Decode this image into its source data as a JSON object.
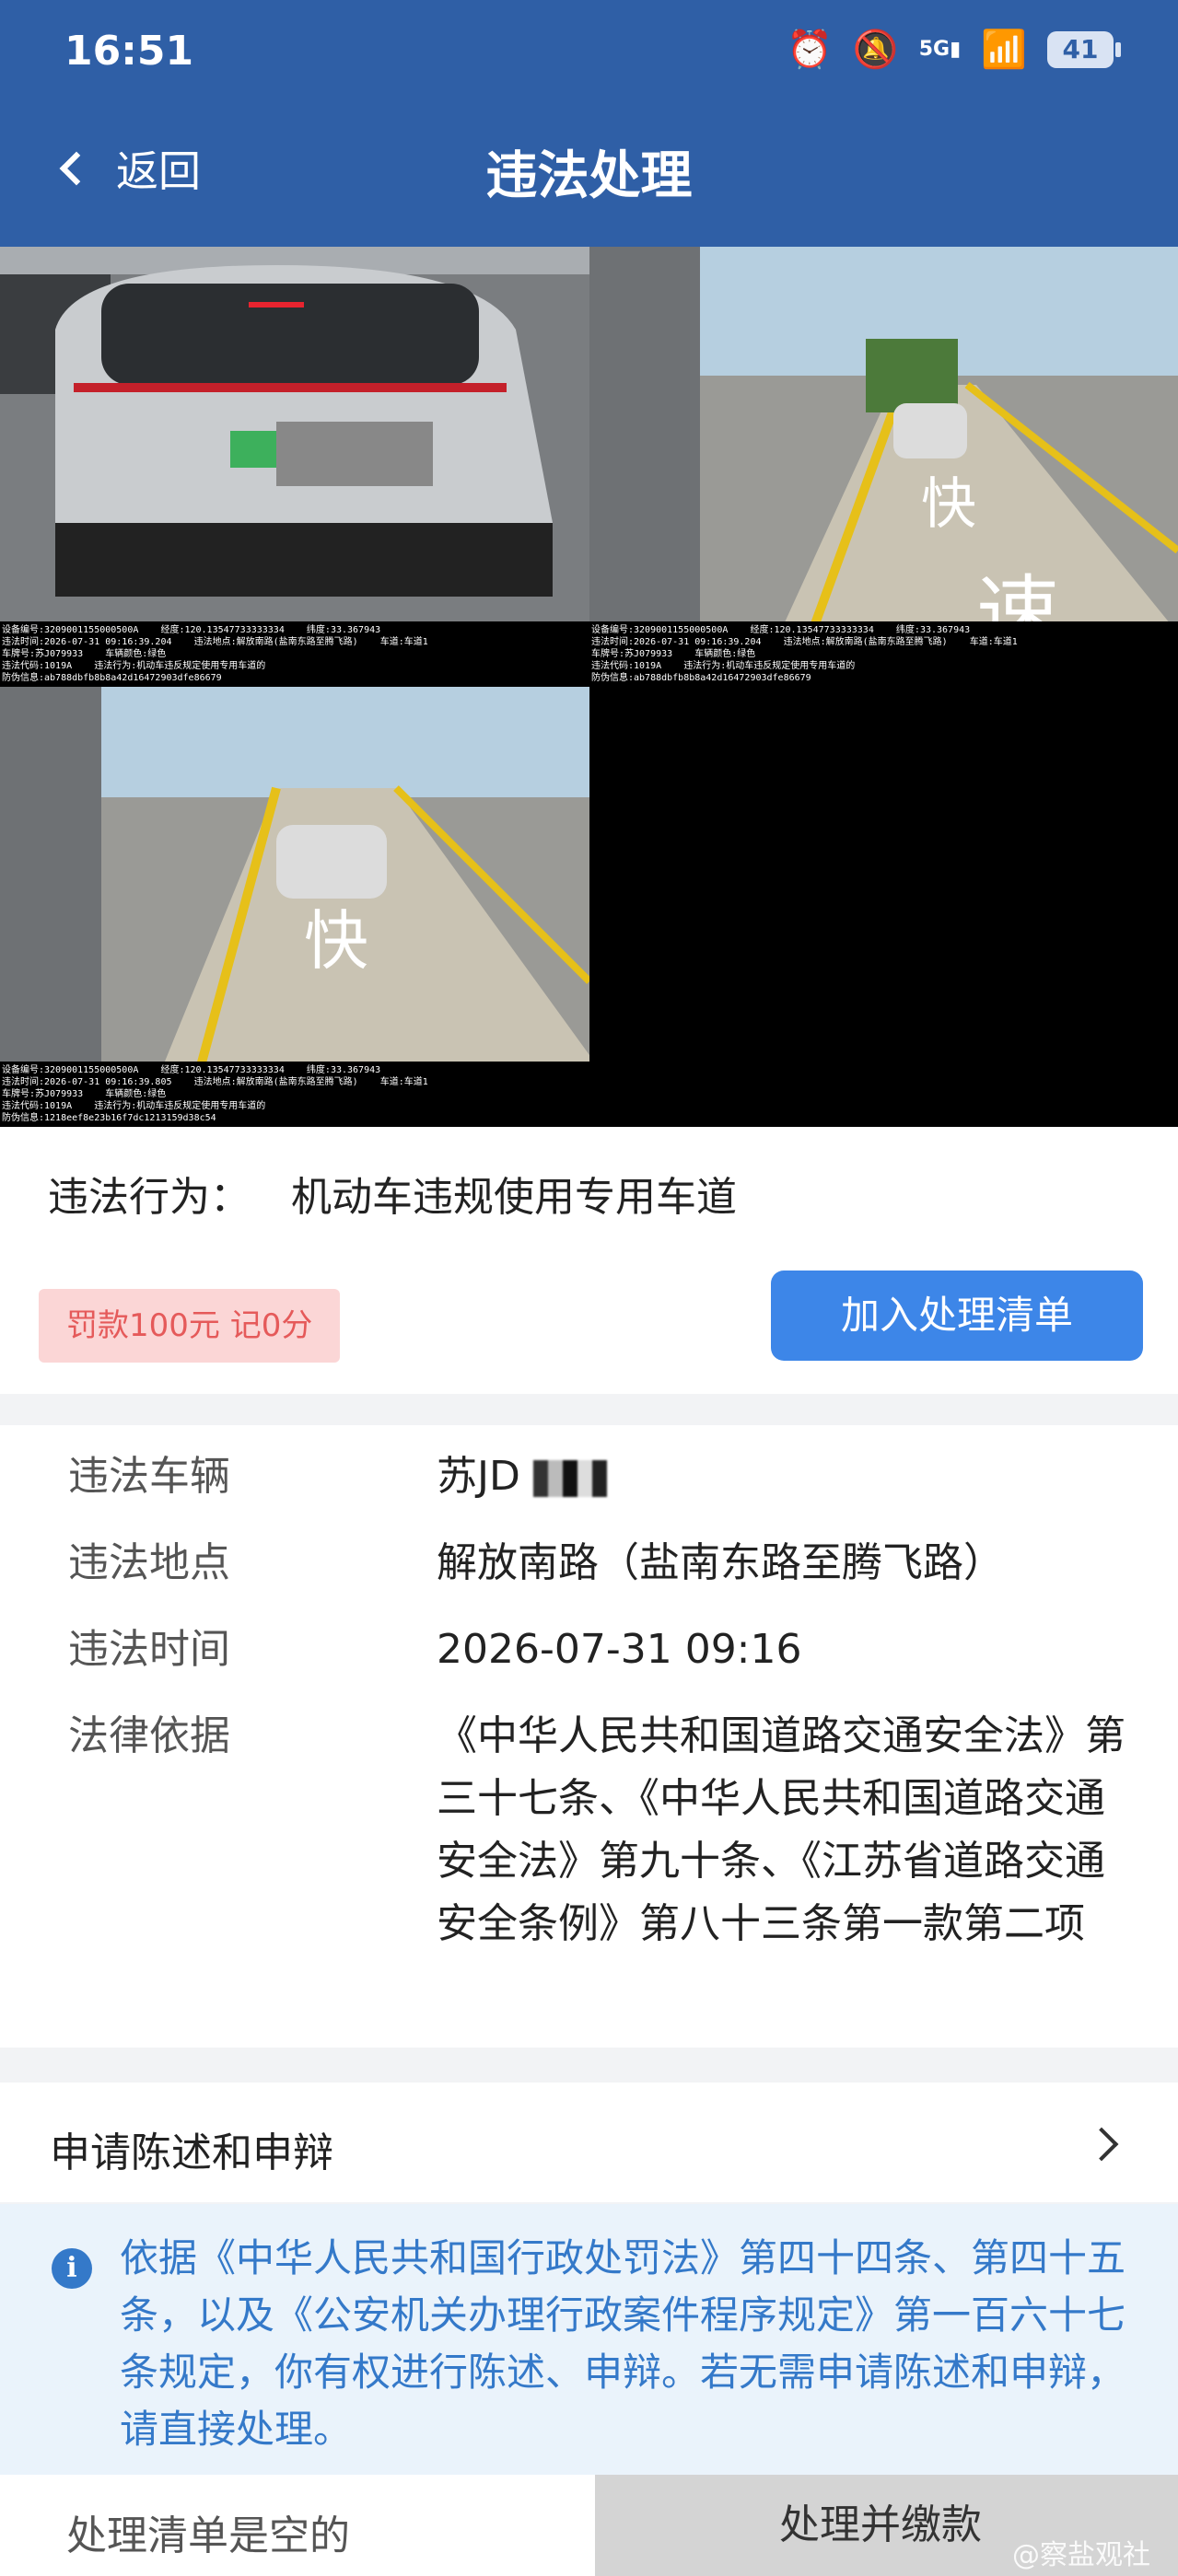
{
  "status_bar": {
    "time": "16:51",
    "battery": "41",
    "network": "5G",
    "icons": [
      "alarm-icon",
      "mute-icon",
      "signal-icon",
      "wifi-icon",
      "wifi-icon",
      "battery-icon"
    ]
  },
  "header": {
    "back_label": "返回",
    "title": "违法处理",
    "background": "#2f5fa6"
  },
  "photos": [
    {
      "caption": "设备编号:3209001155000500A    经度:120.13547733333334    纬度:33.367943\n违法时间:2026-07-31 09:16:39.204    违法地点:解放南路(盐南东路至腾飞路)    车道:车道1\n车牌号:苏J079933    车辆颜色:绿色\n违法代码:1019A    违法行为:机动车违反规定使用专用车道的\n防伪信息:ab788dbfb8b8a42d16472903dfe86679"
    },
    {
      "caption": "设备编号:3209001155000500A    经度:120.13547733333334    纬度:33.367943\n违法时间:2026-07-31 09:16:39.204    违法地点:解放南路(盐南东路至腾飞路)    车道:车道1\n车牌号:苏J079933    车辆颜色:绿色\n违法代码:1019A    违法行为:机动车违反规定使用专用车道的\n防伪信息:ab788dbfb8b8a42d16472903dfe86679"
    },
    {
      "caption": "设备编号:3209001155000500A    经度:120.13547733333334    纬度:33.367943\n违法时间:2026-07-31 09:16:39.805    违法地点:解放南路(盐南东路至腾飞路)    车道:车道1\n车牌号:苏J079933    车辆颜色:绿色\n违法代码:1019A    违法行为:机动车违反规定使用专用车道的\n防伪信息:1218eef8e23b16f7dc1213159d38c54"
    }
  ],
  "behavior": {
    "label": "违法行为：",
    "value": "机动车违规使用专用车道"
  },
  "fine_badge": "罚款100元 记0分",
  "add_button": "加入处理清单",
  "details": [
    {
      "key": "违法车辆",
      "value": "苏JD"
    },
    {
      "key": "违法地点",
      "value": "解放南路（盐南东路至腾飞路）"
    },
    {
      "key": "违法时间",
      "value": "2026-07-31 09:16"
    },
    {
      "key": "法律依据",
      "value": "《中华人民共和国道路交通安全法》第三十七条、《中华人民共和国道路交通安全法》第九十条、《江苏省道路交通安全条例》第八十三条第一款第二项"
    }
  ],
  "appeal": {
    "label": "申请陈述和申辩"
  },
  "notice": {
    "text": "依据《中华人民共和国行政处罚法》第四十四条、第四十五条，以及《公安机关办理行政案件程序规定》第一百六十七条规定，你有权进行陈述、申辩。若无需申请陈述和申辩，请直接处理。"
  },
  "footer": {
    "empty_label": "处理清单是空的",
    "pay_label": "处理并缴款"
  },
  "watermark": "@察盐观社"
}
